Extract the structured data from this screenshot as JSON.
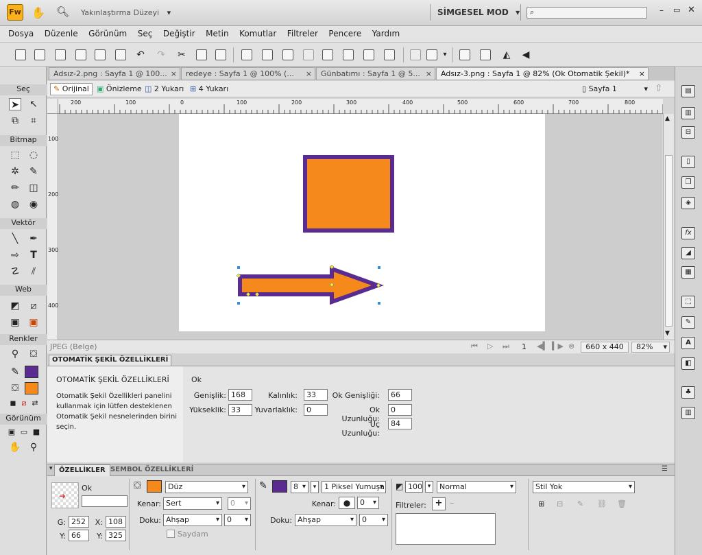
{
  "app": {
    "logo": "Fw",
    "zoom_level_label": "Yakınlaştırma Düzeyi",
    "workspace": "SİMGESEL MOD"
  },
  "menu": [
    "Dosya",
    "Düzenle",
    "Görünüm",
    "Seç",
    "Değiştir",
    "Metin",
    "Komutlar",
    "Filtreler",
    "Pencere",
    "Yardım"
  ],
  "tabs": [
    {
      "label": "Adsız-2.png : Sayfa 1 @ 100...",
      "close": "×"
    },
    {
      "label": "redeye : Sayfa 1 @ 100% (...",
      "close": "×"
    },
    {
      "label": "Günbatımı : Sayfa 1 @ 5...",
      "close": "×"
    },
    {
      "label": "Adsız-3.png : Sayfa 1 @  82% (Ok Otomatik Şekil)*",
      "close": "×"
    }
  ],
  "viewbar": {
    "original": "Orijinal",
    "preview": "Önizleme",
    "two_up": "2 Yukarı",
    "four_up": "4 Yukarı",
    "page": "Sayfa 1"
  },
  "ruler_h": [
    "200",
    "100",
    "0",
    "100",
    "200",
    "300",
    "400",
    "500",
    "600",
    "700",
    "800"
  ],
  "ruler_v": [
    "100",
    "200",
    "300",
    "400"
  ],
  "tools": {
    "select": "Seç",
    "bitmap": "Bitmap",
    "vector": "Vektör",
    "web": "Web",
    "colors": "Renkler",
    "view": "Görünüm"
  },
  "status": {
    "doc_type": "JPEG (Belge)",
    "frame": "1",
    "size": "660 x 440",
    "zoom": "82%"
  },
  "autoshape_panel": {
    "header": "OTOMATİK ŞEKİL ÖZELLİKLERİ",
    "title": "OTOMATİK ŞEKİL ÖZELLİKLERİ",
    "desc": "Otomatik Şekil Özellikleri panelini kullanmak için lütfen desteklenen Otomatik Şekil nesnelerinden birini seçin.",
    "shape": "Ok",
    "width_label": "Genişlik:",
    "width": "168",
    "height_label": "Yükseklik:",
    "height": "33",
    "thickness_label": "Kalınlık:",
    "thickness": "33",
    "roundness_label": "Yuvarlaklık:",
    "roundness": "0",
    "arrow_width_label": "Ok Genişliği:",
    "arrow_width": "66",
    "arrow_length_label": "Ok Uzunluğu:",
    "arrow_length": "0",
    "tip_length_label": "Uç Uzunluğu:",
    "tip_length": "84"
  },
  "properties": {
    "tab1": "ÖZELLİKLER",
    "tab2": "SEMBOL ÖZELLİKLERİ",
    "object_type": "Ok",
    "object_name": "",
    "w_label": "G:",
    "w": "252",
    "x_label": "X:",
    "x": "108",
    "h_label": "Y:",
    "h": "66",
    "y_label": "Y:",
    "y": "325",
    "fill_type": "Düz",
    "edge_label": "Kenar:",
    "edge_value": "Sert",
    "edge_amount": "0",
    "texture_label": "Doku:",
    "texture": "Ahşap",
    "texture_amount": "0",
    "transparent": "Saydam",
    "stroke_size": "8",
    "stroke_type": "1 Piksel Yumuşa",
    "stroke_edge_label": "Kenar:",
    "stroke_edge_amount": "0",
    "stroke_texture_label": "Doku:",
    "stroke_texture": "Ahşap",
    "stroke_texture_amount": "0",
    "opacity": "100",
    "blend": "Normal",
    "filters_label": "Filtreler:",
    "style": "Stil Yok"
  },
  "colors": {
    "fill": "#f5891b",
    "stroke": "#5a2c91"
  }
}
